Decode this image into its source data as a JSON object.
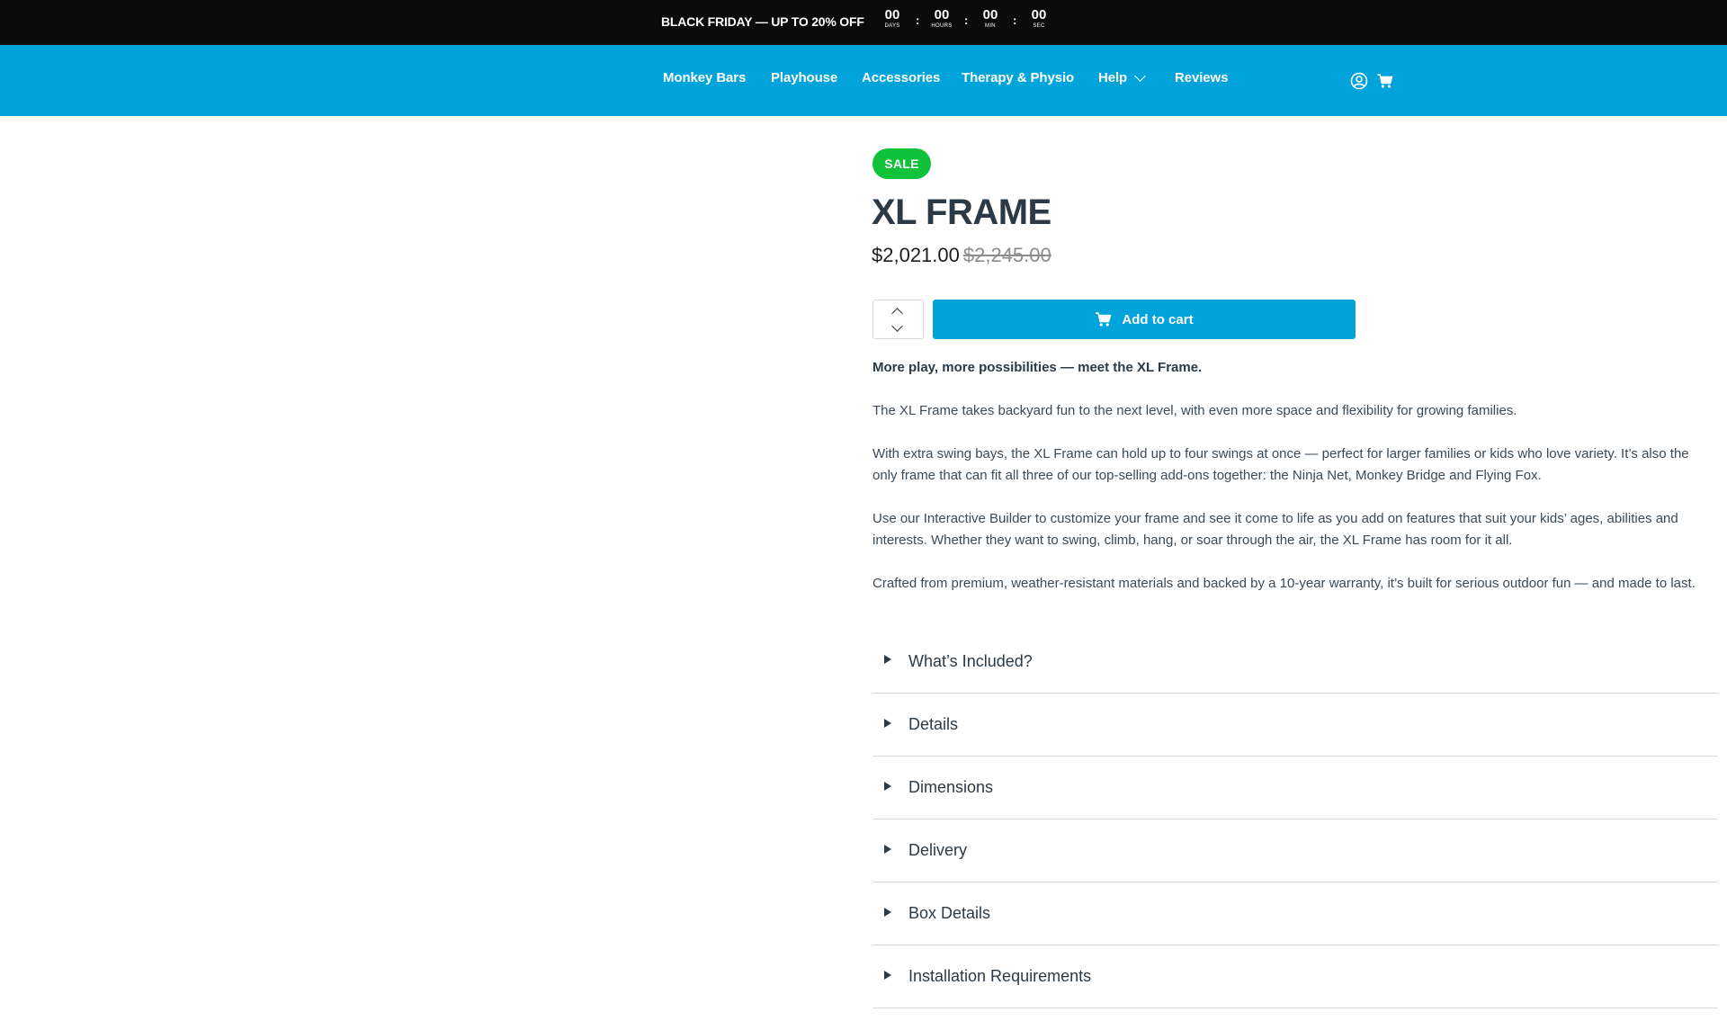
{
  "announcement": {
    "text": "BLACK FRIDAY — UP TO 20% OFF",
    "countdown": [
      {
        "value": "00",
        "label": "DAYS"
      },
      {
        "value": "00",
        "label": "HOURS"
      },
      {
        "value": "00",
        "label": "MIN"
      },
      {
        "value": "00",
        "label": "SEC"
      }
    ],
    "separator": ":"
  },
  "nav": {
    "links": [
      "Monkey Bars",
      "Playhouse",
      "Accessories",
      "Therapy & Physio",
      "Help",
      "Reviews"
    ],
    "icons": [
      "account-icon",
      "cart-icon"
    ]
  },
  "product": {
    "badge": "SALE",
    "title": "XL FRAME",
    "price": "$2,021.00",
    "compare_price": "$2,245.00",
    "quantity": "",
    "add_to_cart": "Add to cart",
    "description": [
      "More play, more possibilities — meet the XL Frame.",
      "The XL Frame takes backyard fun to the next level, with even more space and flexibility for growing families.",
      "With extra swing bays, the XL Frame can hold up to four swings at once — perfect for larger families or kids who love variety. It’s also the only frame that can fit all three of our top-selling add-ons together: the Ninja Net, Monkey Bridge and Flying Fox.",
      "Use our Interactive Builder to customize your frame and see it come to life as you add on features that suit your kids’ ages, abilities and interests. Whether they want to swing, climb, hang, or soar through the air, the XL Frame has room for it all.",
      "Crafted from premium, weather-resistant materials and backed by a 10-year warranty, it’s built for serious outdoor fun — and made to last."
    ],
    "accordion": [
      "What’s Included?",
      "Details",
      "Dimensions",
      "Delivery",
      "Box Details",
      "Installation Requirements"
    ]
  },
  "colors": {
    "brand_blue": "#00a4da",
    "sale_green": "#10c13a",
    "announce_bg": "#0b0b0b",
    "text_dark": "#2b3a46"
  }
}
